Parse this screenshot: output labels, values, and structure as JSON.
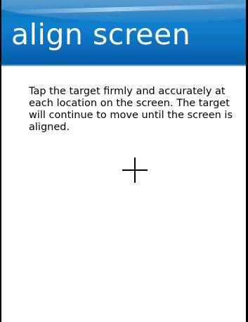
{
  "header": {
    "title": "align screen"
  },
  "main": {
    "instructions": "Tap the target firmly and accurately at each location on the screen. The target will continue to move until the screen is aligned."
  },
  "target": {
    "icon": "crosshair-icon"
  },
  "colors": {
    "title_bar": "#0b73c1",
    "title_text": "#ffffff",
    "background": "#ffffff",
    "text": "#000000"
  }
}
